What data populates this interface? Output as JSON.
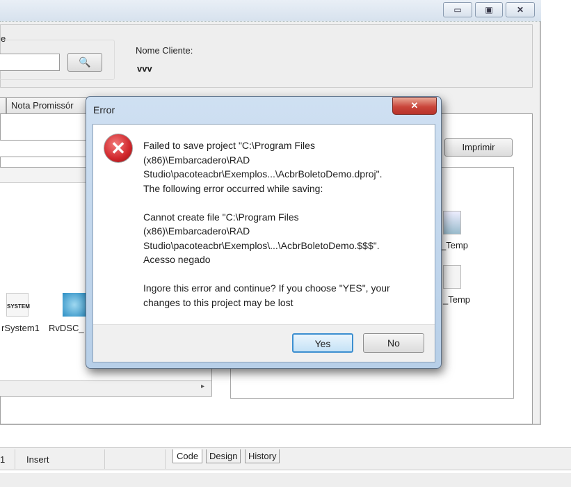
{
  "window": {
    "buttons": [
      "minimize",
      "maximize",
      "close"
    ]
  },
  "top_panel": {
    "group_label": "e",
    "search_input_value": "",
    "cliente_label": "Nome Cliente:",
    "cliente_value": "vvv"
  },
  "tabs": [
    {
      "label": "Nota Promissór"
    }
  ],
  "imprimir_label": "Imprimir",
  "components": [
    {
      "label": "rSystem1",
      "icon": "rvsystem-icon"
    },
    {
      "label": "RvDSC_",
      "icon": "rvdatasetconnection-icon"
    },
    {
      "label": "_Temp",
      "icon": "report-icon"
    },
    {
      "label": "_Temp",
      "icon": "data-flow-icon"
    }
  ],
  "status_bar": {
    "line": "1",
    "mode": "Insert",
    "view_tabs": [
      "Code",
      "Design",
      "History"
    ]
  },
  "dialog": {
    "title": "Error",
    "icon": "error-icon",
    "message_lines": [
      "Failed to save project \"C:\\Program Files",
      "(x86)\\Embarcadero\\RAD",
      "Studio\\pacoteacbr\\Exemplos...\\AcbrBoletoDemo.dproj\".",
      "The following error occurred while saving:",
      "",
      "Cannot create file \"C:\\Program Files",
      "(x86)\\Embarcadero\\RAD",
      "Studio\\pacoteacbr\\Exemplos\\...\\AcbrBoletoDemo.$$$\".",
      "Acesso negado",
      "",
      "Ingore this error and continue? If you choose \"YES\", your",
      "changes to this project may be lost"
    ],
    "yes_label": "Yes",
    "no_label": "No"
  },
  "colors": {
    "dialog_frame": "#b7cfe8",
    "close_button": "#c9453a",
    "error_icon": "#d0262b"
  }
}
